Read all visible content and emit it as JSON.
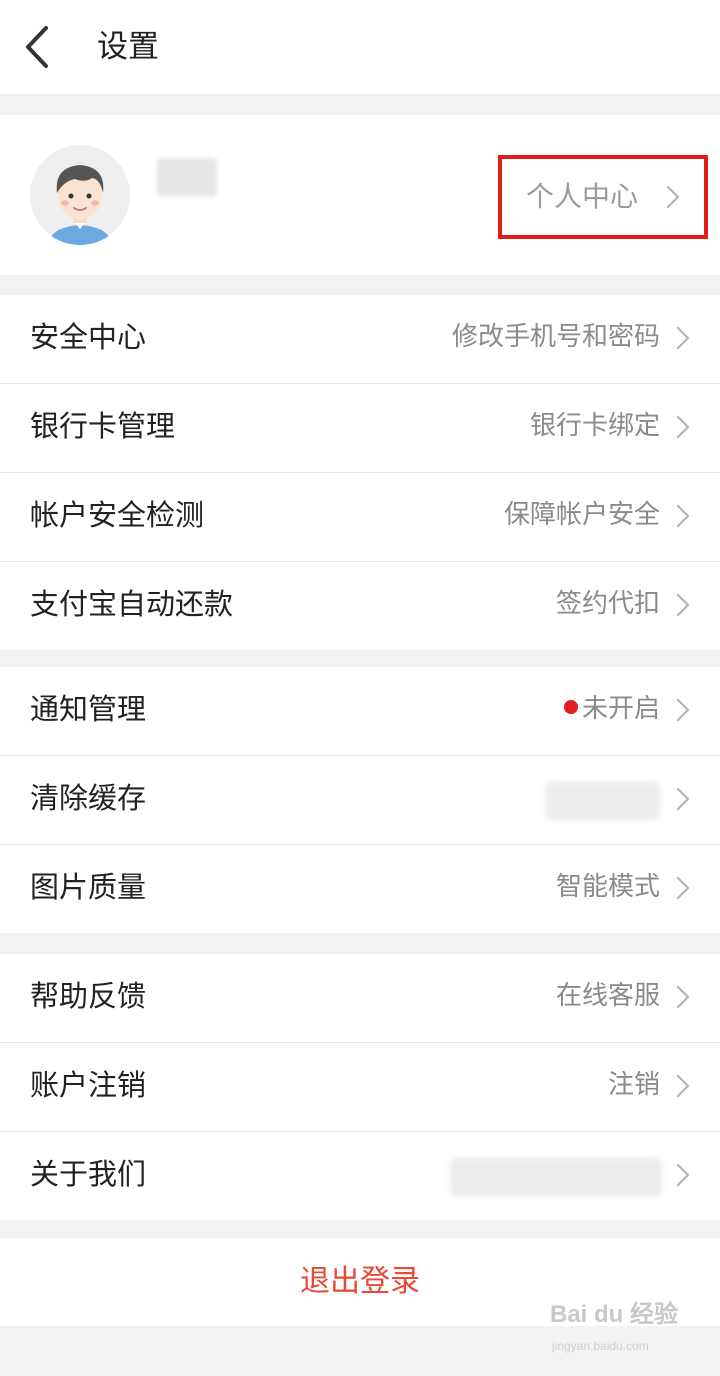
{
  "header": {
    "back_icon": "chevron-left-icon",
    "title": "设置"
  },
  "profile": {
    "avatar_icon": "user-avatar-icon",
    "personal_center": "个人中心"
  },
  "groups": [
    {
      "items": [
        {
          "label": "安全中心",
          "value": "修改手机号和密码"
        },
        {
          "label": "银行卡管理",
          "value": "银行卡绑定"
        },
        {
          "label": "帐户安全检测",
          "value": "保障帐户安全"
        },
        {
          "label": "支付宝自动还款",
          "value": "签约代扣"
        }
      ]
    },
    {
      "items": [
        {
          "label": "通知管理",
          "value": "未开启"
        },
        {
          "label": "清除缓存",
          "value": ""
        },
        {
          "label": "图片质量",
          "value": "智能模式"
        }
      ]
    },
    {
      "items": [
        {
          "label": "帮助反馈",
          "value": "在线客服"
        },
        {
          "label": "账户注销",
          "value": "注销"
        },
        {
          "label": "关于我们",
          "value": ""
        }
      ]
    }
  ],
  "logout": {
    "label": "退出登录"
  },
  "watermark": {
    "main": "Bai du 经验",
    "sub": "jingyan.baidu.com"
  },
  "colors": {
    "accent_red": "#e84a36",
    "highlight_box": "#e21b1b",
    "notify_dot": "#e02020",
    "background": "#f2f2f2"
  }
}
